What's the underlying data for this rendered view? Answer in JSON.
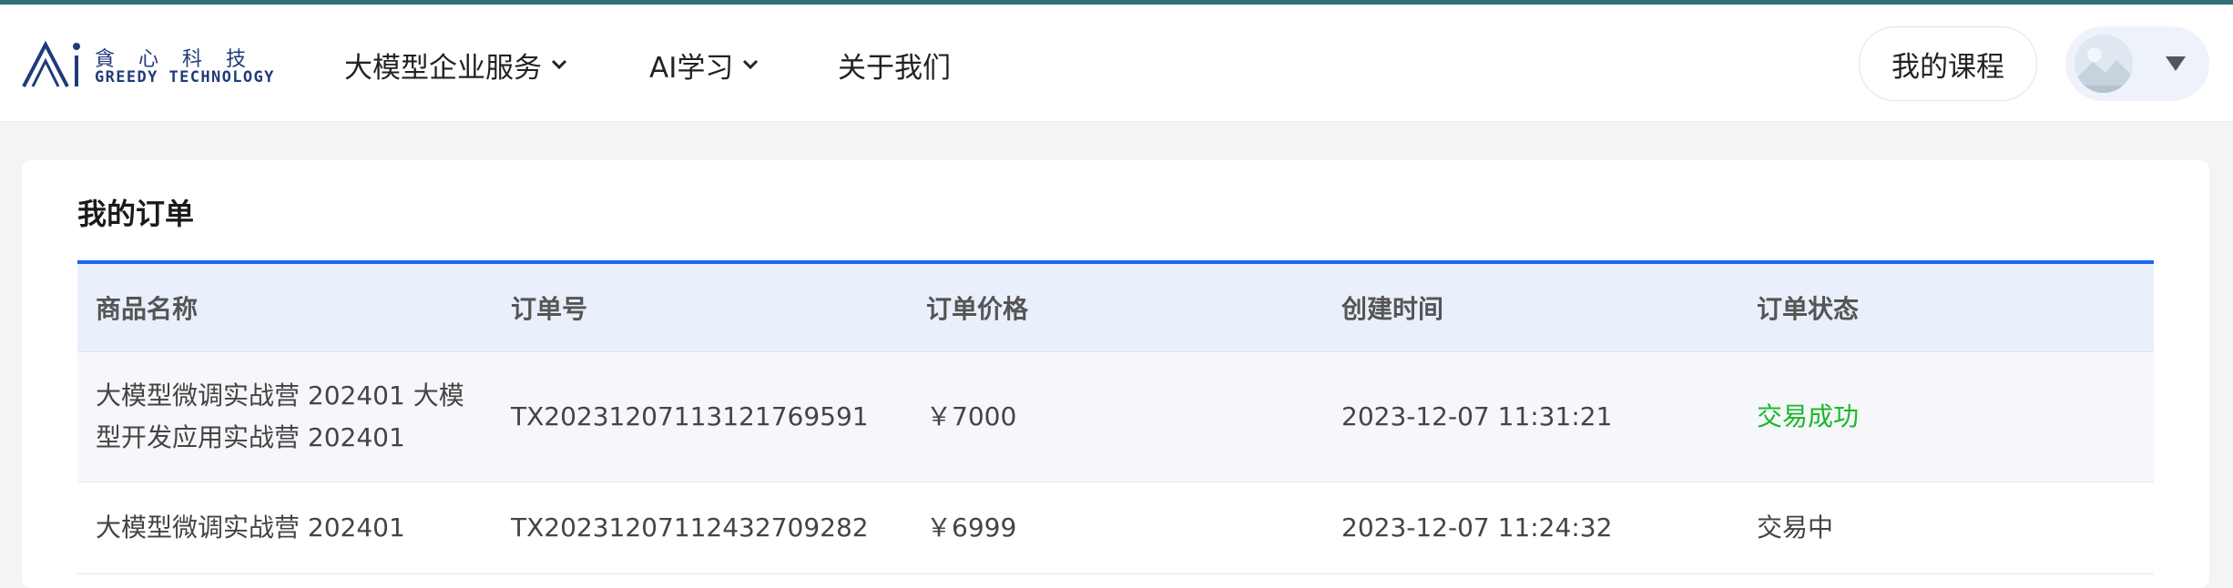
{
  "brand": {
    "cn_name": "貪心科技",
    "en_name": "GREEDY TECHNOLOGY",
    "logo_icon": "greedy-ai-logo"
  },
  "nav": {
    "items": [
      {
        "label": "大模型企业服务",
        "has_dropdown": true
      },
      {
        "label": "AI学习",
        "has_dropdown": true
      },
      {
        "label": "关于我们",
        "has_dropdown": false
      }
    ],
    "my_courses": "我的课程",
    "user_avatar_icon": "avatar-image",
    "user_menu_icon": "caret-down-icon"
  },
  "orders": {
    "title": "我的订单",
    "columns": [
      "商品名称",
      "订单号",
      "订单价格",
      "创建时间",
      "订单状态"
    ],
    "rows": [
      {
        "name": "大模型微调实战营 202401 大模型开发应用实战营 202401",
        "order_no": "TX20231207113121769591",
        "price": "￥7000",
        "created": "2023-12-07 11:31:21",
        "status": "交易成功"
      },
      {
        "name": "大模型微调实战营 202401",
        "order_no": "TX20231207112432709282",
        "price": "￥6999",
        "created": "2023-12-07 11:24:32",
        "status": "交易中"
      }
    ]
  },
  "colors": {
    "accent": "#1c63f0",
    "status_success": "#19b82a",
    "header_bg": "#e9f0fc",
    "brand": "#1f3b7a"
  }
}
